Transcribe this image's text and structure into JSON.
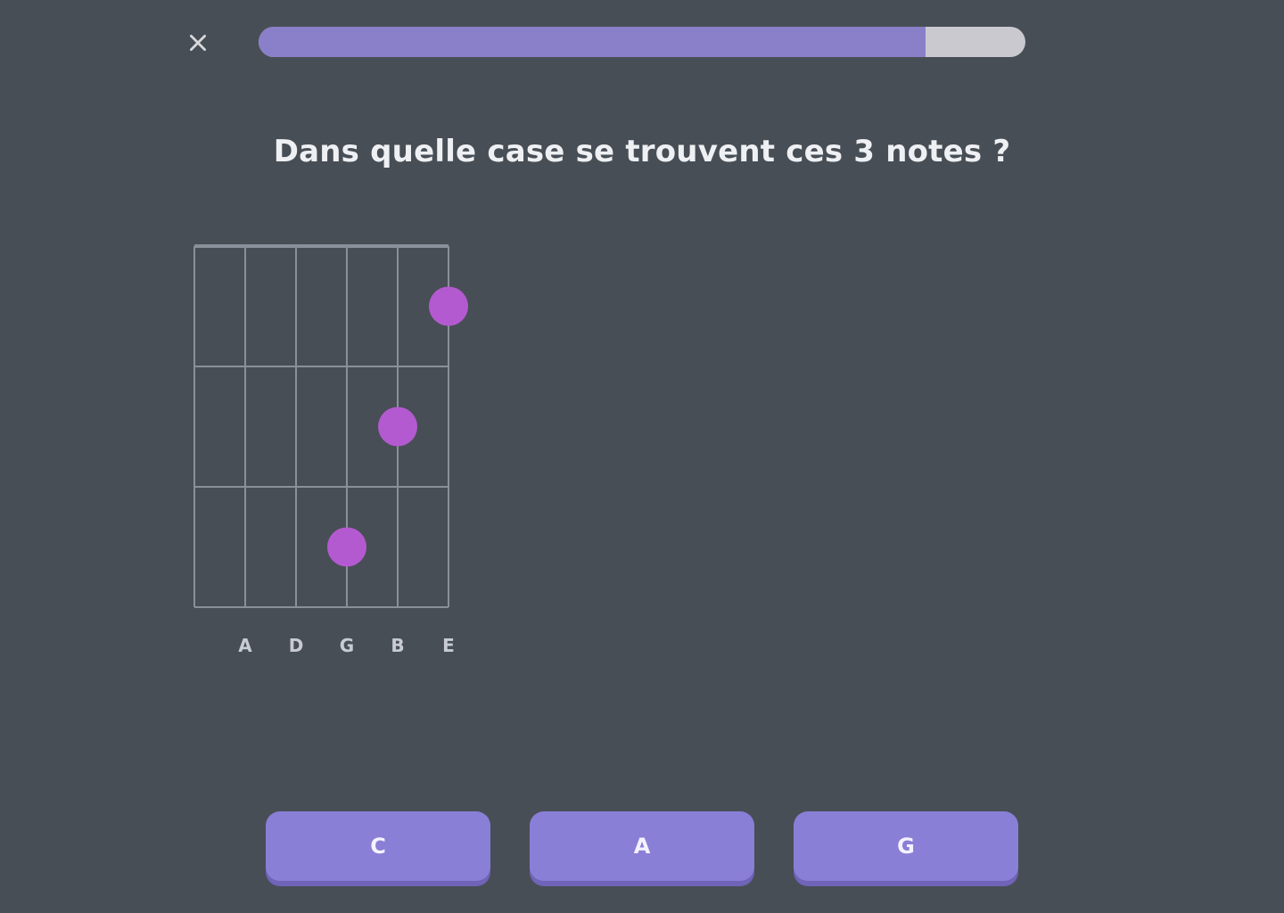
{
  "header": {
    "close_icon": "close-icon",
    "progress": 0.87
  },
  "question": {
    "text": "Dans quelle case se trouvent ces 3 notes ?"
  },
  "fretboard": {
    "strings": 6,
    "frets": 3,
    "dot_color": "#b45ad0",
    "dots": [
      {
        "string": 5,
        "fret": 1
      },
      {
        "string": 4,
        "fret": 2
      },
      {
        "string": 3,
        "fret": 3
      }
    ],
    "string_labels": [
      "",
      "A",
      "D",
      "G",
      "B",
      "E"
    ]
  },
  "answers": [
    {
      "label": "C"
    },
    {
      "label": "A"
    },
    {
      "label": "G"
    }
  ],
  "colors": {
    "background": "#484e56",
    "accent": "#8a7fd6",
    "progress_track": "#c9c9cf"
  }
}
